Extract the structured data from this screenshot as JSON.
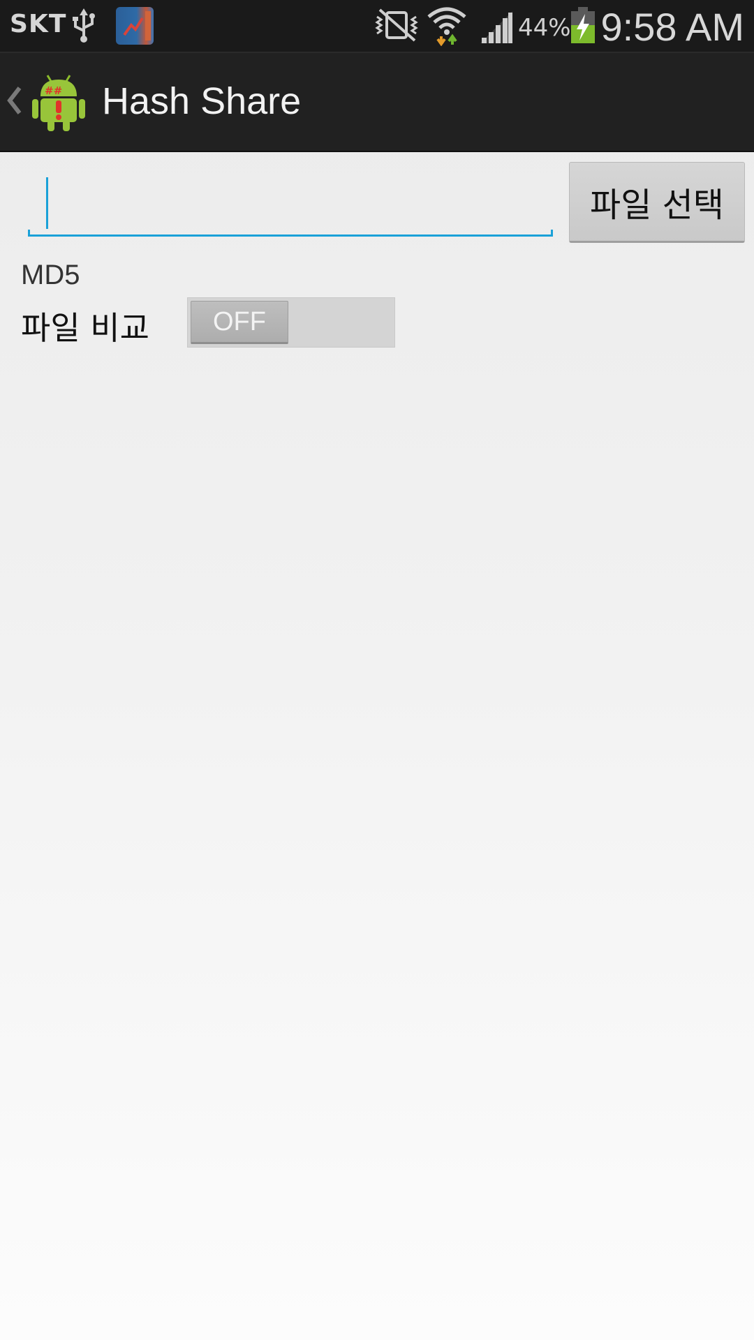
{
  "status_bar": {
    "carrier": "SKT",
    "battery_percent": "44%",
    "time": "9:58 AM",
    "icons": [
      "usb-icon",
      "notification-app-icon",
      "vibrate-mute-icon",
      "wifi-icon",
      "signal-icon",
      "battery-charging-icon"
    ]
  },
  "action_bar": {
    "title": "Hash Share",
    "up_icon": "chevron-left-icon",
    "logo_icon": "android-hash-logo-icon"
  },
  "form": {
    "path_input": {
      "value": "",
      "placeholder": ""
    },
    "file_select_label": "파일 선택",
    "algorithm_label": "MD5",
    "compare_label": "파일 비교",
    "compare_switch": {
      "state_label": "OFF",
      "checked": false
    }
  },
  "colors": {
    "accent": "#1aa1d8",
    "action_bar": "#212121",
    "status_bar": "#1a1a1a"
  }
}
